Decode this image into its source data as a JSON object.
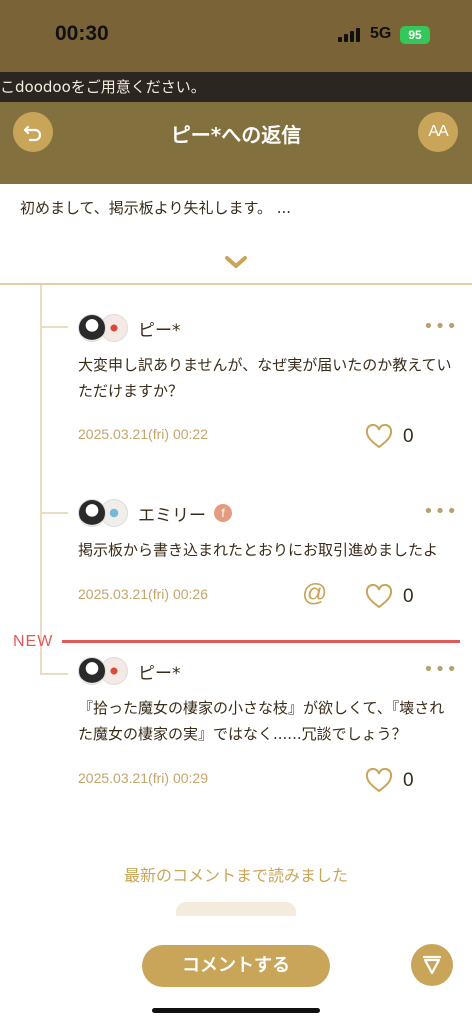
{
  "status_bar": {
    "time": "00:30",
    "network": "5G",
    "battery": "95"
  },
  "ticker": {
    "text": "こdoodooをご用意ください。"
  },
  "header": {
    "title": "ピー*への返信",
    "font_size_label": "AA"
  },
  "parent_post": {
    "preview": "初めまして、掲示板より失礼します。 ..."
  },
  "comments": [
    {
      "user": "ピー*",
      "body": "大変申し訳ありませんが、なぜ実が届いたのか教えていただけますか？",
      "date": "2025.03.21(fri) 00:22",
      "likes": "0"
    },
    {
      "user": "エミリー",
      "badge": "f",
      "body": "掲示板から書き込まれたとおりにお取引進めましたよ",
      "date": "2025.03.21(fri) 00:26",
      "likes": "0"
    },
    {
      "user": "ピー*",
      "body": "『拾った魔女の棲家の小さな枝』が欲しくて、『壊された魔女の棲家の実』ではなく......冗談でしょう？",
      "date": "2025.03.21(fri) 00:29",
      "likes": "0"
    }
  ],
  "new_marker": "NEW",
  "read_all_text": "最新のコメントまで読みました",
  "comment_button": "コメントする",
  "colors": {
    "gold": "#c9a55a",
    "header_bg": "#83703f",
    "new_red": "#e05a5a",
    "date_text": "#c3a56d"
  },
  "icons": [
    "back-arrow-icon",
    "font-size-icon",
    "chevron-down-icon",
    "more-icon",
    "heart-icon",
    "mention-icon",
    "scroll-to-bottom-icon"
  ]
}
